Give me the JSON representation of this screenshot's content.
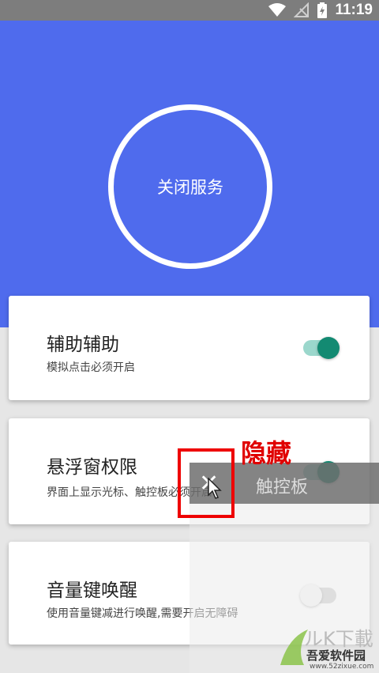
{
  "status_bar": {
    "time": "11:19",
    "icons": [
      "wifi-icon",
      "no-signal-icon",
      "battery-charging-icon"
    ]
  },
  "hero": {
    "button_label": "关闭服务",
    "background_color": "#4f6bed"
  },
  "settings": [
    {
      "title": "辅助辅助",
      "subtitle": "模拟点击必须开启",
      "enabled": true
    },
    {
      "title": "悬浮窗权限",
      "subtitle": "界面上显示光标、触控板必须开启",
      "enabled": true
    },
    {
      "title": "音量键唤醒",
      "subtitle": "使用音量键减进行唤醒,需要开启无障碍",
      "enabled": false
    }
  ],
  "overlay": {
    "label": "触控板",
    "close_icon": "close-icon",
    "annotation": "隐藏"
  },
  "watermark": {
    "text": "吾爱软件园",
    "url": "www.52zixue.com"
  },
  "colors": {
    "accent": "#138a72",
    "highlight": "#e00000"
  }
}
